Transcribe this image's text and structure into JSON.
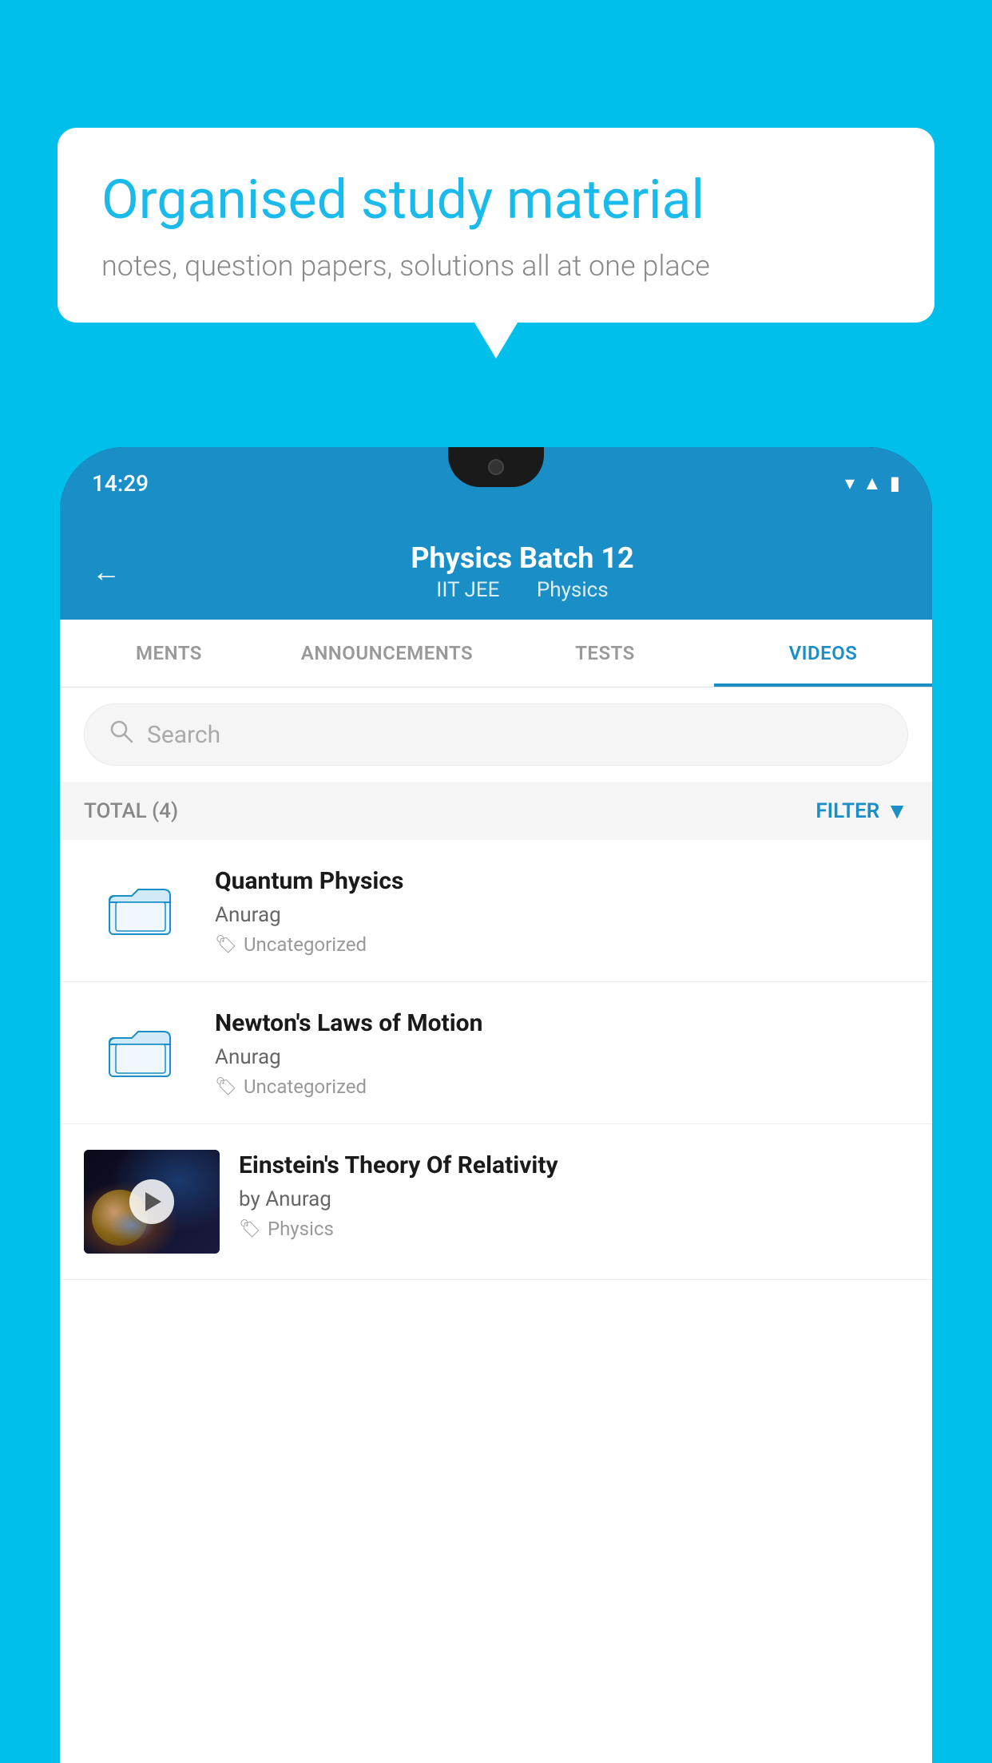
{
  "background": {
    "color": "#00BFEA"
  },
  "speech_bubble": {
    "title": "Organised study material",
    "subtitle": "notes, question papers, solutions all at one place"
  },
  "phone": {
    "status_bar": {
      "time": "14:29"
    },
    "header": {
      "back_label": "←",
      "title": "Physics Batch 12",
      "subtitle_part1": "IIT JEE",
      "subtitle_part2": "Physics"
    },
    "tabs": [
      {
        "label": "MENTS",
        "active": false
      },
      {
        "label": "ANNOUNCEMENTS",
        "active": false
      },
      {
        "label": "TESTS",
        "active": false
      },
      {
        "label": "VIDEOS",
        "active": true
      }
    ],
    "search": {
      "placeholder": "Search"
    },
    "filter_bar": {
      "total_label": "TOTAL (4)",
      "filter_label": "FILTER"
    },
    "videos": [
      {
        "id": "quantum",
        "title": "Quantum Physics",
        "author": "Anurag",
        "tag": "Uncategorized",
        "has_thumbnail": false
      },
      {
        "id": "newton",
        "title": "Newton's Laws of Motion",
        "author": "Anurag",
        "tag": "Uncategorized",
        "has_thumbnail": false
      },
      {
        "id": "einstein",
        "title": "Einstein's Theory Of Relativity",
        "author": "by Anurag",
        "tag": "Physics",
        "has_thumbnail": true
      }
    ]
  }
}
